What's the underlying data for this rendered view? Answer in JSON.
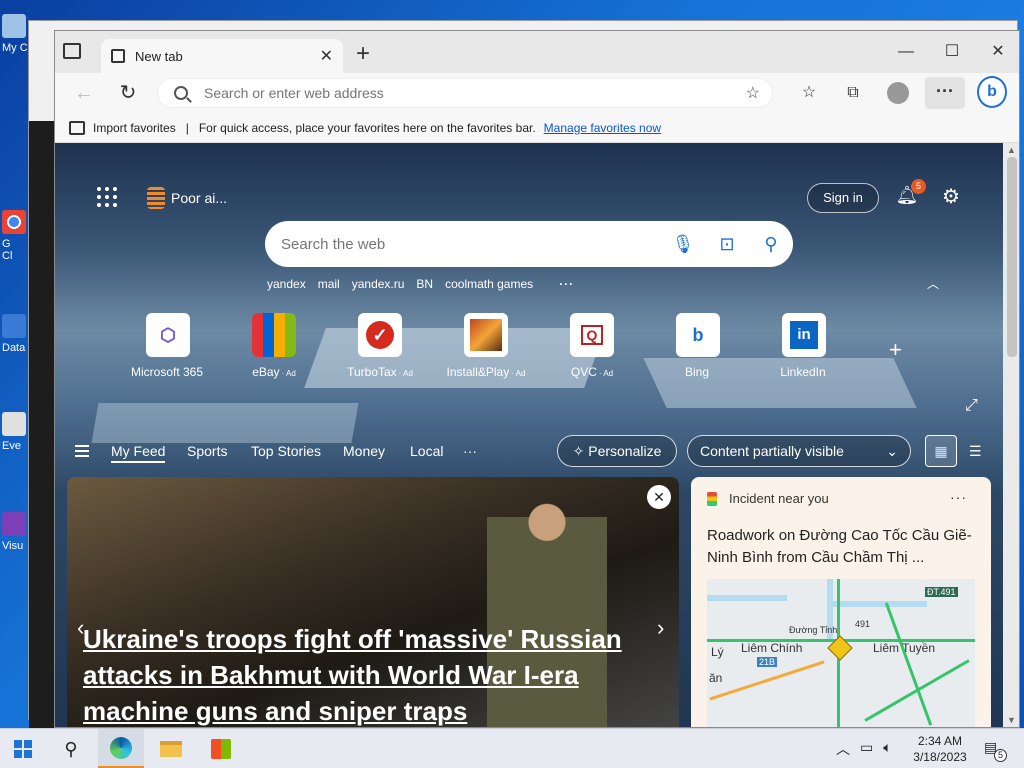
{
  "desktop": {
    "icons": [
      {
        "label": "My C"
      },
      {
        "label": "G\nCl"
      },
      {
        "label": "Data"
      },
      {
        "label": "Eve"
      },
      {
        "label": "Visu"
      }
    ]
  },
  "browser": {
    "tab": {
      "title": "New tab"
    },
    "address": {
      "placeholder": "Search or enter web address"
    },
    "favorites_bar": {
      "import_label": "Import favorites",
      "message": "For quick access, place your favorites here on the favorites bar.",
      "manage_link": "Manage favorites now"
    }
  },
  "newtab": {
    "weather_label": "Poor ai...",
    "signin_label": "Sign in",
    "notification_count": "5",
    "search_placeholder": "Search the web",
    "suggestions": [
      "yandex",
      "mail",
      "yandex.ru",
      "BN",
      "coolmath games"
    ],
    "suggestions_more": "···",
    "tiles": [
      {
        "label": "Microsoft 365",
        "ad": ""
      },
      {
        "label": "eBay",
        "ad": "· Ad"
      },
      {
        "label": "TurboTax",
        "ad": "· Ad"
      },
      {
        "label": "Install&Play",
        "ad": "· Ad"
      },
      {
        "label": "QVC",
        "ad": "· Ad"
      },
      {
        "label": "Bing",
        "ad": ""
      },
      {
        "label": "LinkedIn",
        "ad": ""
      }
    ],
    "feed_tabs": [
      "My Feed",
      "Sports",
      "Top Stories",
      "Money",
      "Local"
    ],
    "feed_more": "···",
    "personalize_label": "Personalize",
    "content_visibility": "Content partially visible",
    "hero": {
      "title": "Ukraine's troops fight off 'massive' Russian attacks in Bakhmut with World War I-era machine guns and sniper traps"
    },
    "incident": {
      "header": "Incident near you",
      "description": "Roadwork on Đường Cao Tốc Cầu Giẽ-Ninh Bình from Cầu Chầm Thị ...",
      "map_labels": {
        "l1": "Liêm Chính",
        "l2": "Liêm Tuyền",
        "l3": "Lý",
        "l4": "Đường Tỉnh",
        "l5": "ĐT.491",
        "l6": "21B",
        "l7": "491",
        "l8": "ăn"
      }
    }
  },
  "taskbar": {
    "time": "2:34 AM",
    "date": "3/18/2023",
    "notification_count": "5"
  },
  "colors": {
    "accent": "#0b57d0",
    "badge": "#e45c23"
  }
}
